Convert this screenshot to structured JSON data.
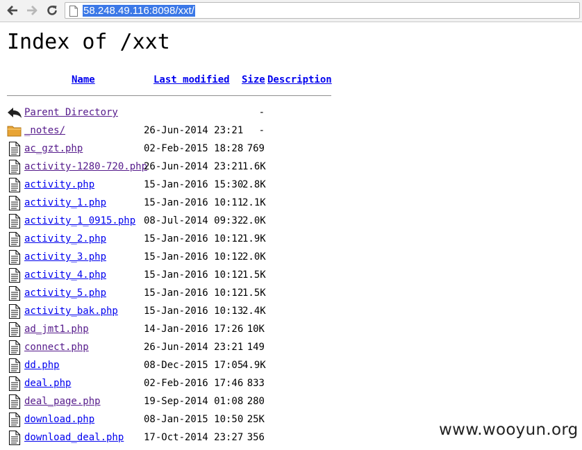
{
  "browser": {
    "url": "58.248.49.116:8098/xxt/",
    "back_icon": "arrow-left-icon",
    "forward_icon": "arrow-right-icon",
    "reload_icon": "reload-icon"
  },
  "page": {
    "title": "Index of /xxt",
    "columns": {
      "name": "Name",
      "modified": "Last modified",
      "size": "Size",
      "description": "Description"
    }
  },
  "entries": [
    {
      "icon": "back-folder-icon",
      "name": "Parent Directory",
      "modified": "",
      "size": "-",
      "visited": true
    },
    {
      "icon": "folder-icon",
      "name": "_notes/",
      "modified": "26-Jun-2014 23:21",
      "size": "-",
      "visited": true
    },
    {
      "icon": "file-icon",
      "name": "ac_gzt.php",
      "modified": "02-Feb-2015 18:28",
      "size": "769",
      "visited": true
    },
    {
      "icon": "file-icon",
      "name": "activity-1280-720.php",
      "modified": "26-Jun-2014 23:21",
      "size": "1.6K",
      "visited": true
    },
    {
      "icon": "file-icon",
      "name": "activity.php",
      "modified": "15-Jan-2016 15:30",
      "size": "2.8K",
      "visited": false
    },
    {
      "icon": "file-icon",
      "name": "activity_1.php",
      "modified": "15-Jan-2016 10:11",
      "size": "2.1K",
      "visited": false
    },
    {
      "icon": "file-icon",
      "name": "activity_1_0915.php",
      "modified": "08-Jul-2014 09:32",
      "size": "2.0K",
      "visited": false
    },
    {
      "icon": "file-icon",
      "name": "activity_2.php",
      "modified": "15-Jan-2016 10:12",
      "size": "1.9K",
      "visited": false
    },
    {
      "icon": "file-icon",
      "name": "activity_3.php",
      "modified": "15-Jan-2016 10:12",
      "size": "2.0K",
      "visited": false
    },
    {
      "icon": "file-icon",
      "name": "activity_4.php",
      "modified": "15-Jan-2016 10:12",
      "size": "1.5K",
      "visited": false
    },
    {
      "icon": "file-icon",
      "name": "activity_5.php",
      "modified": "15-Jan-2016 10:12",
      "size": "1.5K",
      "visited": false
    },
    {
      "icon": "file-icon",
      "name": "activity_bak.php",
      "modified": "15-Jan-2016 10:13",
      "size": "2.4K",
      "visited": false
    },
    {
      "icon": "file-icon",
      "name": "ad_jmt1.php",
      "modified": "14-Jan-2016 17:26",
      "size": "10K",
      "visited": true
    },
    {
      "icon": "file-icon",
      "name": "connect.php",
      "modified": "26-Jun-2014 23:21",
      "size": "149",
      "visited": true
    },
    {
      "icon": "file-icon",
      "name": "dd.php",
      "modified": "08-Dec-2015 17:05",
      "size": "4.9K",
      "visited": false
    },
    {
      "icon": "file-icon",
      "name": "deal.php",
      "modified": "02-Feb-2016 17:46",
      "size": "833",
      "visited": false
    },
    {
      "icon": "file-icon",
      "name": "deal_page.php",
      "modified": "19-Sep-2014 01:08",
      "size": "280",
      "visited": true
    },
    {
      "icon": "file-icon",
      "name": "download.php",
      "modified": "08-Jan-2015 10:50",
      "size": "25K",
      "visited": false
    },
    {
      "icon": "file-icon",
      "name": "download_deal.php",
      "modified": "17-Oct-2014 23:27",
      "size": "356",
      "visited": false
    }
  ],
  "watermark": "www.wooyun.org"
}
